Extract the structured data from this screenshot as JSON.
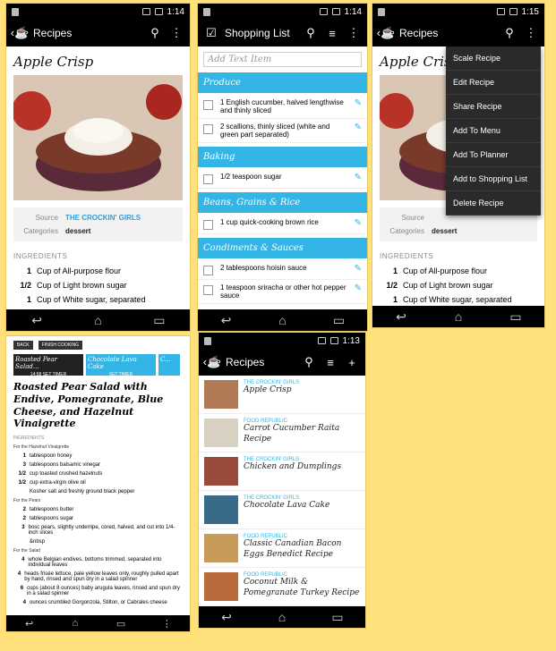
{
  "screen1": {
    "time": "1:14",
    "title": "Recipes",
    "recipe_title": "Apple Crisp",
    "source_label": "Source",
    "source_value": "THE CROCKIN' GIRLS",
    "categories_label": "Categories",
    "categories_value": "dessert",
    "ingredients_head": "INGREDIENTS",
    "ingredients": [
      {
        "q": "1",
        "t": "Cup of All-purpose flour"
      },
      {
        "q": "1/2",
        "t": "Cup of Light brown sugar"
      },
      {
        "q": "1",
        "t": "Cup of White sugar, separated"
      }
    ]
  },
  "screen2": {
    "time": "1:14",
    "title": "Shopping List",
    "add_placeholder": "Add Text Item",
    "categories": [
      {
        "name": "Produce",
        "items": [
          "1 English cucumber, halved lengthwise and thinly sliced",
          "2 scallions, thinly sliced (white and green part separated)"
        ]
      },
      {
        "name": "Baking",
        "items": [
          "1/2 teaspoon sugar"
        ]
      },
      {
        "name": "Beans, Grains & Rice",
        "items": [
          "1 cup quick-cooking brown rice"
        ]
      },
      {
        "name": "Condiments & Sauces",
        "items": [
          "2 tablespoons hoisin sauce",
          "1 teaspoon sriracha or other hot pepper sauce"
        ]
      }
    ]
  },
  "screen3": {
    "time": "1:15",
    "title": "Recipes",
    "recipe_title": "Apple Crisp",
    "menu": [
      "Scale Recipe",
      "Edit Recipe",
      "Share Recipe",
      "Add To Menu",
      "Add To Planner",
      "Add to Shopping List",
      "Delete Recipe"
    ],
    "source_label": "Source",
    "categories_label": "Categories",
    "categories_value": "dessert",
    "ingredients_head": "INGREDIENTS",
    "ingredients": [
      {
        "q": "1",
        "t": "Cup of All-purpose flour"
      },
      {
        "q": "1/2",
        "t": "Cup of Light brown sugar"
      },
      {
        "q": "1",
        "t": "Cup of White sugar, separated"
      }
    ]
  },
  "screen4": {
    "back": "BACK",
    "finish": "FINISH COOKING",
    "tabs": [
      {
        "name": "Roasted Pear Salad...",
        "time": "14:58",
        "btn": "SET TIMER"
      },
      {
        "name": "Chocolate Lava Cake",
        "btn": "SET TIMER"
      },
      {
        "name": "C...",
        "btn": ""
      }
    ],
    "title": "Roasted Pear Salad with Endive, Pomegranate, Blue Cheese, and Hazelnut Vinaigrette",
    "ingredients_head": "INGREDIENTS",
    "group1": "For the Hazelnut Vinaigrette",
    "ing1": [
      {
        "q": "1",
        "t": "tablespoon honey"
      },
      {
        "q": "3",
        "t": "tablespoons balsamic vinegar"
      },
      {
        "q": "1/2",
        "t": "cup toasted crushed hazelnuts"
      },
      {
        "q": "1/2",
        "t": "cup extra-virgin olive oil"
      },
      {
        "q": "",
        "t": "Kosher salt and freshly ground black pepper"
      }
    ],
    "group2": "For the Pears",
    "ing2": [
      {
        "q": "2",
        "t": "tablespoons butter"
      },
      {
        "q": "2",
        "t": "tablespoons sugar"
      },
      {
        "q": "3",
        "t": "bosc pears, slightly underripe, cored, halved, and cut into 1/4-inch slices"
      },
      {
        "q": "",
        "t": "&nbsp"
      }
    ],
    "group3": "For the Salad",
    "ing3": [
      {
        "q": "4",
        "t": "whole Belgian endives, bottoms trimmed, separated into individual leaves"
      },
      {
        "q": "4",
        "t": "heads frisée lettuce, pale yellow leaves only, roughly pulled apart by hand, rinsed and spun dry in a salad spinner"
      },
      {
        "q": "6",
        "t": "cups (about 8 ounces) baby arugula leaves, rinsed and spun dry in a salad spinner"
      },
      {
        "q": "4",
        "t": "ounces crumbled Gorgonzola, Stilton, or Cabrales cheese"
      }
    ]
  },
  "screen5": {
    "time": "1:13",
    "title": "Recipes",
    "items": [
      {
        "src": "THE CROCKIN' GIRLS",
        "title": "Apple Crisp",
        "color": "#b07a55"
      },
      {
        "src": "FOOD REPUBLIC",
        "title": "Carrot Cucumber Raita Recipe",
        "color": "#d8d0c0"
      },
      {
        "src": "THE CROCKIN' GIRLS",
        "title": "Chicken and Dumplings",
        "color": "#9a4a3a"
      },
      {
        "src": "THE CROCKIN' GIRLS",
        "title": "Chocolate Lava Cake",
        "color": "#3a6a8a"
      },
      {
        "src": "FOOD REPUBLIC",
        "title": "Classic Canadian Bacon Eggs Benedict Recipe",
        "color": "#c89a5a"
      },
      {
        "src": "FOOD REPUBLIC",
        "title": "Coconut Milk & Pomegranate Turkey Recipe",
        "color": "#b86a3a"
      }
    ]
  }
}
